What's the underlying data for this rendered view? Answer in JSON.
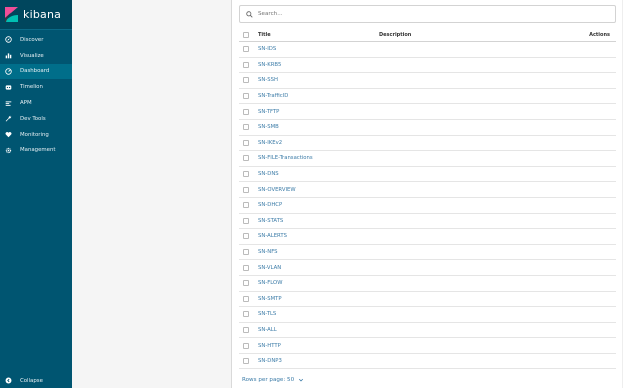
{
  "brand": {
    "name": "kibana"
  },
  "nav": [
    {
      "label": "Discover",
      "icon": "compass-icon",
      "active": false
    },
    {
      "label": "Visualize",
      "icon": "bar-chart-icon",
      "active": false
    },
    {
      "label": "Dashboard",
      "icon": "dashboard-icon",
      "active": true
    },
    {
      "label": "Timelion",
      "icon": "timelion-icon",
      "active": false
    },
    {
      "label": "APM",
      "icon": "apm-icon",
      "active": false
    },
    {
      "label": "Dev Tools",
      "icon": "wrench-icon",
      "active": false
    },
    {
      "label": "Monitoring",
      "icon": "heartbeat-icon",
      "active": false
    },
    {
      "label": "Management",
      "icon": "gear-icon",
      "active": false
    }
  ],
  "collapse": {
    "label": "Collapse",
    "icon": "collapse-icon"
  },
  "search": {
    "placeholder": "Search..."
  },
  "table": {
    "headers": {
      "title": "Title",
      "description": "Description",
      "actions": "Actions"
    },
    "rows": [
      "SN-IDS",
      "SN-KRB5",
      "SN-SSH",
      "SN-TrafficID",
      "SN-TFTP",
      "SN-SMB",
      "SN-IKEv2",
      "SN-FILE-Transactions",
      "SN-DNS",
      "SN-OVERVIEW",
      "SN-DHCP",
      "SN-STATS",
      "SN-ALERTS",
      "SN-NFS",
      "SN-VLAN",
      "SN-FLOW",
      "SN-SMTP",
      "SN-TLS",
      "SN-ALL",
      "SN-HTTP",
      "SN-DNP3"
    ]
  },
  "pagination": {
    "rows_per_page": "Rows per page: 50"
  },
  "colors": {
    "sidebar": "#005571",
    "active": "#006e8a",
    "link": "#3b7ba7"
  }
}
